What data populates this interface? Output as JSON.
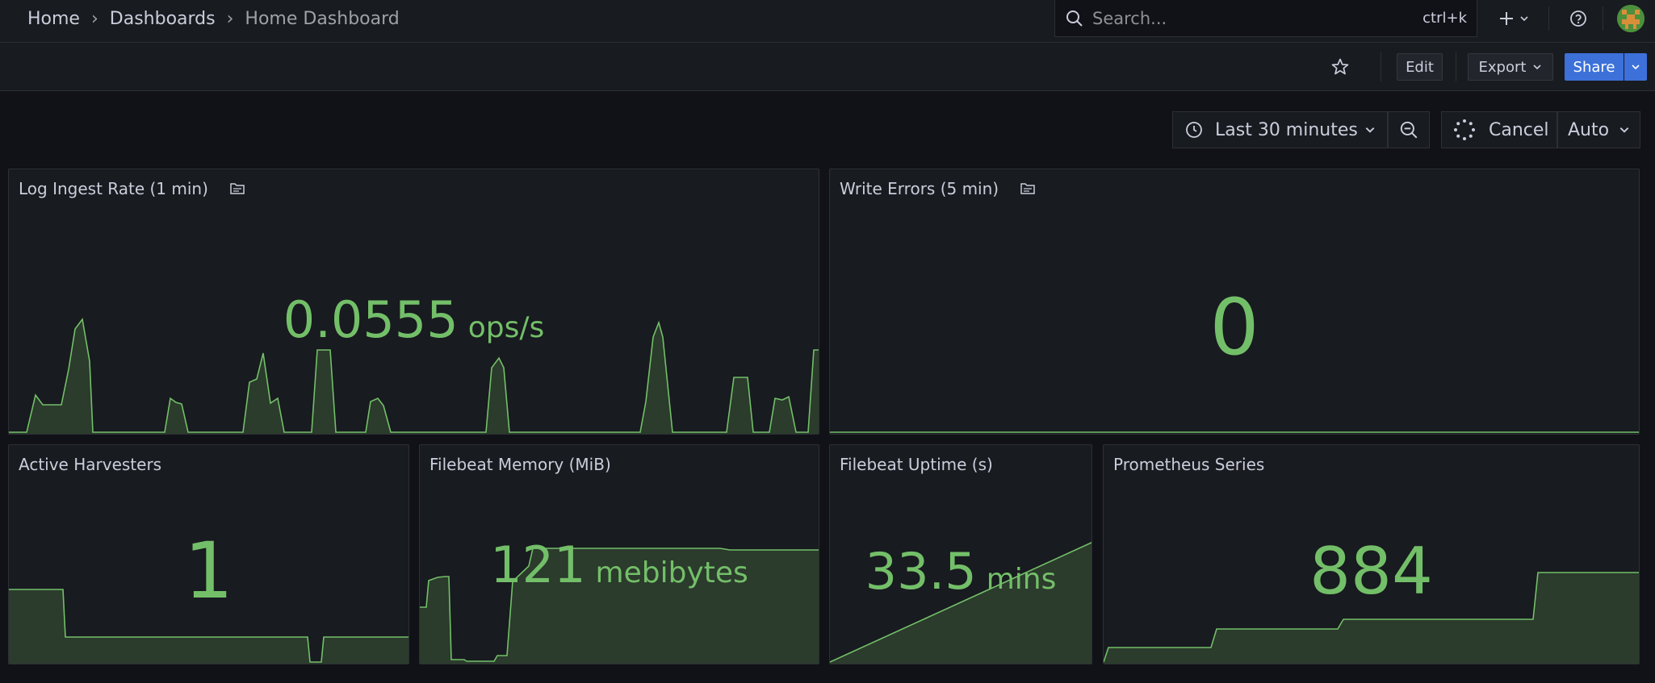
{
  "breadcrumb": {
    "home": "Home",
    "dashboards": "Dashboards",
    "current": "Home Dashboard"
  },
  "search": {
    "placeholder": "Search...",
    "shortcut": "ctrl+k"
  },
  "toolbar": {
    "edit_label": "Edit",
    "export_label": "Export",
    "share_label": "Share"
  },
  "time": {
    "range_label": "Last 30 minutes",
    "cancel_label": "Cancel",
    "refresh_label": "Auto"
  },
  "panels": {
    "log_ingest": {
      "title": "Log Ingest Rate (1 min)",
      "value": "0.0555",
      "unit": "ops/s"
    },
    "write_errors": {
      "title": "Write Errors (5 min)",
      "value": "0"
    },
    "harvesters": {
      "title": "Active Harvesters",
      "value": "1"
    },
    "memory": {
      "title": "Filebeat Memory (MiB)",
      "value": "121",
      "unit": "mebibytes"
    },
    "uptime": {
      "title": "Filebeat Uptime (s)",
      "value": "33.5",
      "unit": "mins"
    },
    "series": {
      "title": "Prometheus Series",
      "value": "884"
    }
  },
  "colors": {
    "accent": "#73bf69",
    "primary_button": "#3d71d9",
    "background": "#111217",
    "panel": "#181b1f"
  }
}
